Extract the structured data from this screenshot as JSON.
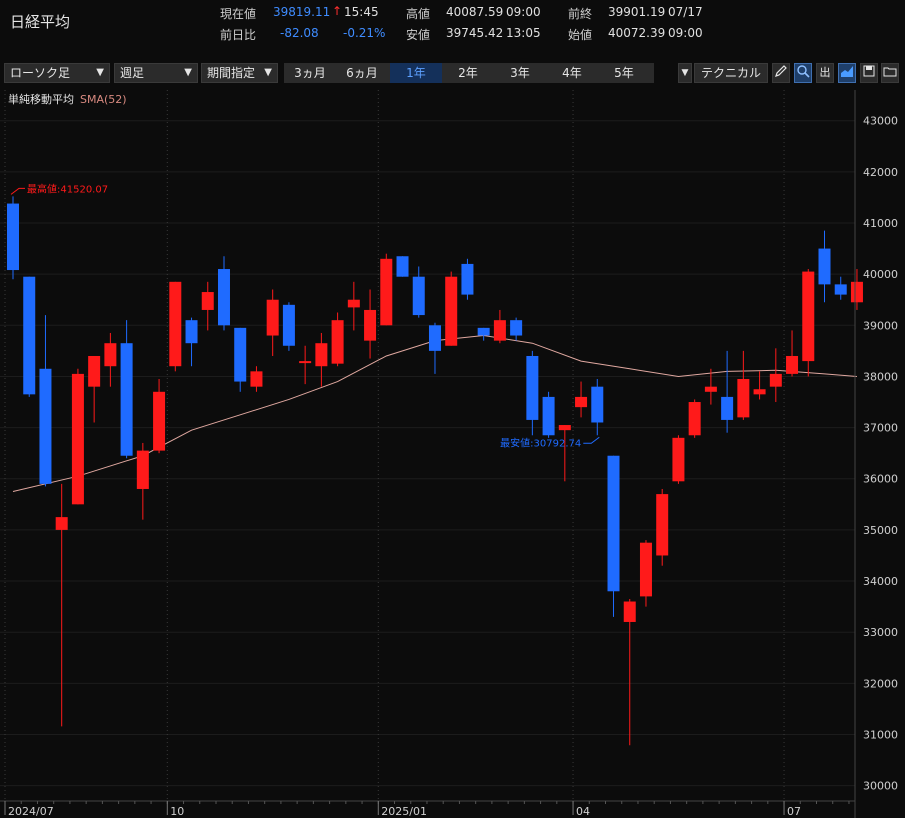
{
  "header": {
    "title": "日経平均",
    "current_label": "現在値",
    "current_value": "39819.11",
    "current_arrow": "↑",
    "current_time": "15:45",
    "change_label": "前日比",
    "change_value": "-82.08",
    "change_pct": "-0.21%",
    "high_label": "高値",
    "high_value": "40087.59",
    "high_time": "09:00",
    "low_label": "安値",
    "low_value": "39745.42",
    "low_time": "13:05",
    "prev_label": "前終",
    "prev_value": "39901.19",
    "prev_date": "07/17",
    "open_label": "始値",
    "open_value": "40072.39",
    "open_time": "09:00"
  },
  "toolbar": {
    "chart_type": "ローソク足",
    "period": "週足",
    "range_mode": "期間指定",
    "ranges": [
      "3ヵ月",
      "6ヵ月",
      "1年",
      "2年",
      "3年",
      "4年",
      "5年"
    ],
    "selected_range": "1年",
    "technical": "テクニカル",
    "icons": [
      "pencil-icon",
      "zoom-icon",
      "volume-icon",
      "area-chart-icon",
      "save-icon",
      "folder-icon",
      "print-icon"
    ],
    "volume_label": "出"
  },
  "colors": {
    "up": "#ff1a1a",
    "down": "#1f6bff",
    "sma": "#e0a8a0",
    "grid": "#3a3a3a",
    "background": "#0c0c0c"
  },
  "chart_data": {
    "type": "candlestick",
    "indicator_label": "単純移動平均",
    "sma_label": "SMA(52)",
    "ylim": [
      29700,
      43600
    ],
    "yticks": [
      30000,
      31000,
      32000,
      33000,
      34000,
      35000,
      36000,
      37000,
      38000,
      39000,
      40000,
      41000,
      42000,
      43000
    ],
    "xtick_labels": [
      {
        "label": "2024/07",
        "index": 0
      },
      {
        "label": "10",
        "index": 10
      },
      {
        "label": "2025/01",
        "index": 23
      },
      {
        "label": "04",
        "index": 35
      },
      {
        "label": "07",
        "index": 48
      }
    ],
    "max_annotation": "最高値:41520.07",
    "min_annotation": "最安値:30792.74",
    "max_index": 0,
    "min_index": 36,
    "candles": [
      {
        "o": 41380,
        "h": 41520,
        "l": 39900,
        "c": 40080
      },
      {
        "o": 39950,
        "h": 39950,
        "l": 37600,
        "c": 37650
      },
      {
        "o": 38150,
        "h": 39200,
        "l": 35850,
        "c": 35900
      },
      {
        "o": 35000,
        "h": 35900,
        "l": 31160,
        "c": 35250
      },
      {
        "o": 35500,
        "h": 38150,
        "l": 35500,
        "c": 38050
      },
      {
        "o": 37800,
        "h": 38400,
        "l": 37100,
        "c": 38400
      },
      {
        "o": 38200,
        "h": 38850,
        "l": 37800,
        "c": 38650
      },
      {
        "o": 38650,
        "h": 39100,
        "l": 36400,
        "c": 36450
      },
      {
        "o": 35800,
        "h": 36700,
        "l": 35200,
        "c": 36550
      },
      {
        "o": 36550,
        "h": 37950,
        "l": 36500,
        "c": 37700
      },
      {
        "o": 38200,
        "h": 39850,
        "l": 38100,
        "c": 39850
      },
      {
        "o": 39100,
        "h": 39150,
        "l": 38200,
        "c": 38650
      },
      {
        "o": 39300,
        "h": 39850,
        "l": 38900,
        "c": 39650
      },
      {
        "o": 40100,
        "h": 40350,
        "l": 38900,
        "c": 39000
      },
      {
        "o": 38950,
        "h": 38950,
        "l": 37700,
        "c": 37900
      },
      {
        "o": 37800,
        "h": 38200,
        "l": 37700,
        "c": 38100
      },
      {
        "o": 38800,
        "h": 39700,
        "l": 38400,
        "c": 39500
      },
      {
        "o": 39400,
        "h": 39450,
        "l": 38500,
        "c": 38600
      },
      {
        "o": 38270,
        "h": 38600,
        "l": 37850,
        "c": 38300
      },
      {
        "o": 38200,
        "h": 38850,
        "l": 37800,
        "c": 38650
      },
      {
        "o": 38250,
        "h": 39250,
        "l": 38200,
        "c": 39100
      },
      {
        "o": 39350,
        "h": 39850,
        "l": 38900,
        "c": 39500
      },
      {
        "o": 38700,
        "h": 39700,
        "l": 38350,
        "c": 39300
      },
      {
        "o": 39000,
        "h": 40400,
        "l": 39000,
        "c": 40300
      },
      {
        "o": 40350,
        "h": 40350,
        "l": 39950,
        "c": 39950
      },
      {
        "o": 39950,
        "h": 40150,
        "l": 39150,
        "c": 39200
      },
      {
        "o": 39000,
        "h": 39050,
        "l": 38050,
        "c": 38500
      },
      {
        "o": 38600,
        "h": 40050,
        "l": 38600,
        "c": 39950
      },
      {
        "o": 40200,
        "h": 40300,
        "l": 39500,
        "c": 39600
      },
      {
        "o": 38950,
        "h": 38950,
        "l": 38700,
        "c": 38800
      },
      {
        "o": 38700,
        "h": 39300,
        "l": 38650,
        "c": 39100
      },
      {
        "o": 39100,
        "h": 39150,
        "l": 38700,
        "c": 38800
      },
      {
        "o": 38400,
        "h": 38500,
        "l": 36850,
        "c": 37150
      },
      {
        "o": 37600,
        "h": 37700,
        "l": 36800,
        "c": 36850
      },
      {
        "o": 36950,
        "h": 37050,
        "l": 35950,
        "c": 37050
      },
      {
        "o": 37400,
        "h": 37900,
        "l": 37200,
        "c": 37600
      },
      {
        "o": 37800,
        "h": 37950,
        "l": 36850,
        "c": 37100
      },
      {
        "o": 36450,
        "h": 36450,
        "l": 33300,
        "c": 33800
      },
      {
        "o": 33200,
        "h": 33650,
        "l": 30790,
        "c": 33600
      },
      {
        "o": 33700,
        "h": 34800,
        "l": 33500,
        "c": 34750
      },
      {
        "o": 34500,
        "h": 35800,
        "l": 34300,
        "c": 35700
      },
      {
        "o": 35950,
        "h": 36850,
        "l": 35900,
        "c": 36800
      },
      {
        "o": 36850,
        "h": 37550,
        "l": 36800,
        "c": 37500
      },
      {
        "o": 37700,
        "h": 38150,
        "l": 37450,
        "c": 37800
      },
      {
        "o": 37600,
        "h": 38500,
        "l": 36900,
        "c": 37150
      },
      {
        "o": 37200,
        "h": 38500,
        "l": 37150,
        "c": 37950
      },
      {
        "o": 37650,
        "h": 38100,
        "l": 37550,
        "c": 37750
      },
      {
        "o": 37800,
        "h": 38550,
        "l": 37500,
        "c": 38050
      },
      {
        "o": 38050,
        "h": 38900,
        "l": 38000,
        "c": 38400
      },
      {
        "o": 38300,
        "h": 40100,
        "l": 38000,
        "c": 40050
      },
      {
        "o": 40500,
        "h": 40850,
        "l": 39450,
        "c": 39800
      },
      {
        "o": 39800,
        "h": 39950,
        "l": 39500,
        "c": 39600
      },
      {
        "o": 39450,
        "h": 40100,
        "l": 39300,
        "c": 39850
      }
    ],
    "sma": [
      [
        0,
        35750
      ],
      [
        4,
        36050
      ],
      [
        8,
        36450
      ],
      [
        11,
        36950
      ],
      [
        14,
        37250
      ],
      [
        17,
        37550
      ],
      [
        20,
        37900
      ],
      [
        23,
        38400
      ],
      [
        26,
        38700
      ],
      [
        29,
        38800
      ],
      [
        32,
        38650
      ],
      [
        35,
        38300
      ],
      [
        38,
        38150
      ],
      [
        41,
        38000
      ],
      [
        44,
        38100
      ],
      [
        47,
        38120
      ],
      [
        50,
        38050
      ],
      [
        52,
        38000
      ]
    ]
  }
}
